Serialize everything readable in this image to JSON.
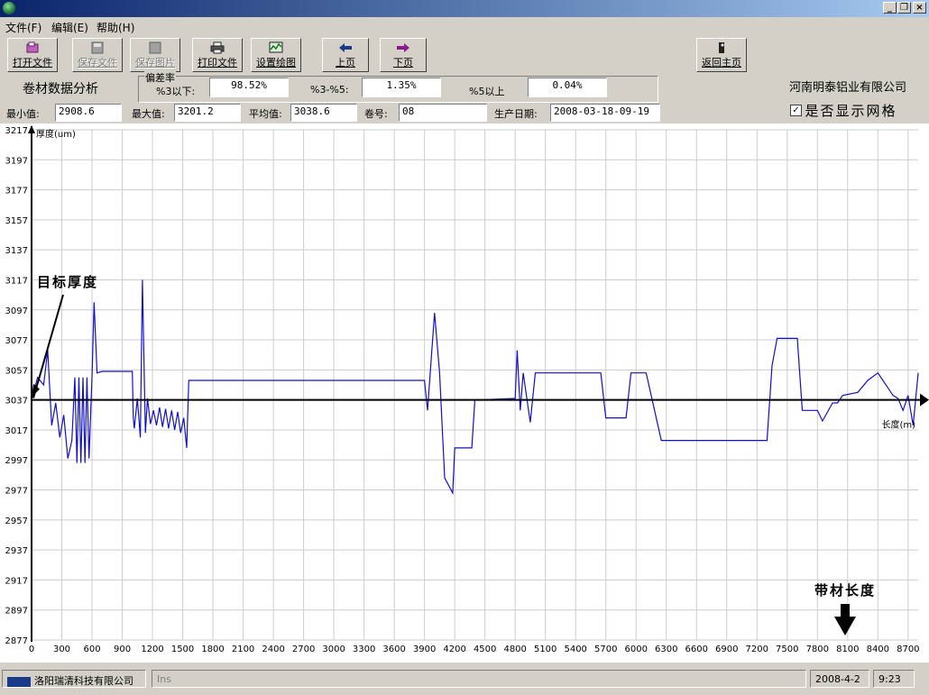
{
  "menu": [
    "文件(F)",
    "编辑(E)",
    "帮助(H)"
  ],
  "toolbar": {
    "open_label": "打开文件",
    "save_file_label": "保存文件",
    "save_image_label": "保存图片",
    "print_label": "打印文件",
    "plot_settings_label": "设置绘图",
    "prev_label": "上页",
    "next_label": "下页",
    "home_label": "返回主页"
  },
  "header": {
    "title": "卷材数据分析",
    "company": "河南明泰铝业有限公司",
    "deviation_group_label": "偏差率",
    "below3_label": "%3以下:",
    "below3_value": "98.52%",
    "between3_5_label": "%3-%5:",
    "between3_5_value": "1.35%",
    "above5_label": "%5以上",
    "above5_value": "0.04%",
    "min_label": "最小值:",
    "min_value": "2908.6",
    "max_label": "最大值:",
    "max_value": "3201.2",
    "avg_label": "平均值:",
    "avg_value": "3038.6",
    "coil_label": "卷号:",
    "coil_value": "08",
    "date_label": "生产日期:",
    "date_value": "2008-03-18-09-19",
    "grid_checkbox_label": "是否显示网格",
    "grid_checked": true
  },
  "chart_data": {
    "type": "line",
    "ylabel": "厚度(um)",
    "xlabel": "长度(m)",
    "target_label": "目标厚度",
    "strip_length_label": "带材长度",
    "target_value": 3037,
    "xlim": [
      0,
      8800
    ],
    "ylim": [
      2877,
      3217
    ],
    "x_ticks": [
      0,
      300,
      600,
      900,
      1200,
      1500,
      1800,
      2100,
      2400,
      2700,
      3000,
      3300,
      3600,
      3900,
      4200,
      4500,
      4800,
      5100,
      5400,
      5700,
      6000,
      6300,
      6600,
      6900,
      7200,
      7500,
      7800,
      8100,
      8400,
      8700
    ],
    "y_ticks": [
      2877,
      2897,
      2917,
      2937,
      2957,
      2977,
      2997,
      3017,
      3037,
      3057,
      3077,
      3097,
      3117,
      3137,
      3157,
      3177,
      3197,
      3217
    ],
    "grid": true,
    "line_color": "#1010cc",
    "x": [
      0,
      60,
      120,
      160,
      200,
      240,
      280,
      320,
      360,
      400,
      430,
      450,
      470,
      490,
      510,
      530,
      550,
      570,
      600,
      620,
      650,
      700,
      800,
      900,
      1000,
      1010,
      1020,
      1050,
      1080,
      1100,
      1130,
      1150,
      1180,
      1210,
      1240,
      1270,
      1300,
      1330,
      1360,
      1390,
      1420,
      1450,
      1480,
      1510,
      1540,
      1560,
      1600,
      1700,
      2000,
      2500,
      3000,
      3500,
      3800,
      3900,
      3930,
      4000,
      4050,
      4100,
      4180,
      4200,
      4300,
      4370,
      4400,
      4450,
      4800,
      4820,
      4850,
      4880,
      4950,
      5000,
      5100,
      5500,
      5650,
      5700,
      5900,
      5950,
      6000,
      6100,
      6250,
      6300,
      6500,
      7000,
      7300,
      7350,
      7400,
      7600,
      7650,
      7800,
      7850,
      7950,
      8000,
      8050,
      8200,
      8300,
      8400,
      8450,
      8500,
      8550,
      8600,
      8650,
      8700,
      8750,
      8800
    ],
    "values": [
      3037,
      3052,
      3047,
      3070,
      3020,
      3035,
      3012,
      3027,
      2998,
      3010,
      3052,
      2995,
      3052,
      2995,
      3052,
      2995,
      3052,
      2998,
      3052,
      3102,
      3055,
      3056,
      3056,
      3056,
      3056,
      3025,
      3018,
      3038,
      3012,
      3117,
      3015,
      3038,
      3021,
      3030,
      3020,
      3032,
      3019,
      3031,
      3018,
      3030,
      3017,
      3029,
      3015,
      3025,
      3005,
      3050,
      3050,
      3050,
      3050,
      3050,
      3050,
      3050,
      3050,
      3050,
      3030,
      3095,
      3055,
      2985,
      2975,
      3005,
      3005,
      3005,
      3037,
      3037,
      3038,
      3070,
      3030,
      3055,
      3022,
      3055,
      3055,
      3055,
      3055,
      3025,
      3025,
      3055,
      3055,
      3055,
      3010,
      3010,
      3010,
      3010,
      3010,
      3060,
      3078,
      3078,
      3030,
      3030,
      3023,
      3035,
      3035,
      3040,
      3042,
      3050,
      3055,
      3050,
      3045,
      3040,
      3038,
      3030,
      3040,
      3020,
      3055
    ]
  }
}
